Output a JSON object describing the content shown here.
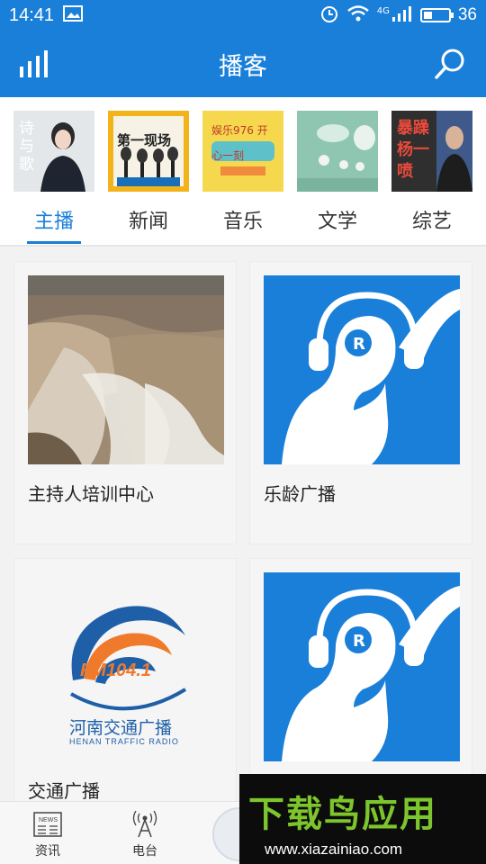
{
  "status": {
    "time": "14:41",
    "network": "4G",
    "battery": "36",
    "battery_level": 0.36
  },
  "header": {
    "title": "播客",
    "left_icon": "equalizer-icon",
    "search_icon": "search-icon"
  },
  "category_images": [
    {
      "text": "诗与歌"
    },
    {
      "text": "第一现场"
    },
    {
      "text": "娱乐976 开心一刻"
    },
    {
      "text": ""
    },
    {
      "text": "暴躁杨一喷"
    }
  ],
  "tabs": [
    {
      "label": "主播",
      "active": true
    },
    {
      "label": "新闻",
      "active": false
    },
    {
      "label": "音乐",
      "active": false
    },
    {
      "label": "文学",
      "active": false
    },
    {
      "label": "综艺",
      "active": false
    }
  ],
  "cards": [
    {
      "title": "主持人培训中心",
      "image": "waterfall-photo"
    },
    {
      "title": "乐龄广播",
      "image": "radio-logo"
    },
    {
      "title": "交通广播",
      "image": "fm1041-logo",
      "logo_text": "FM104.1",
      "logo_caption": "河南交通广播",
      "logo_subcaption": "HENAN TRAFFIC RADIO"
    },
    {
      "title": "",
      "image": "radio-logo"
    }
  ],
  "bottom_nav": [
    {
      "label": "资讯",
      "icon": "news-icon"
    },
    {
      "label": "电台",
      "icon": "antenna-icon"
    }
  ],
  "watermark": {
    "title": "下载鸟应用",
    "url": "www.xiazainiao.com"
  },
  "colors": {
    "primary": "#1a7fd9",
    "watermark_green": "#7dc52d"
  }
}
